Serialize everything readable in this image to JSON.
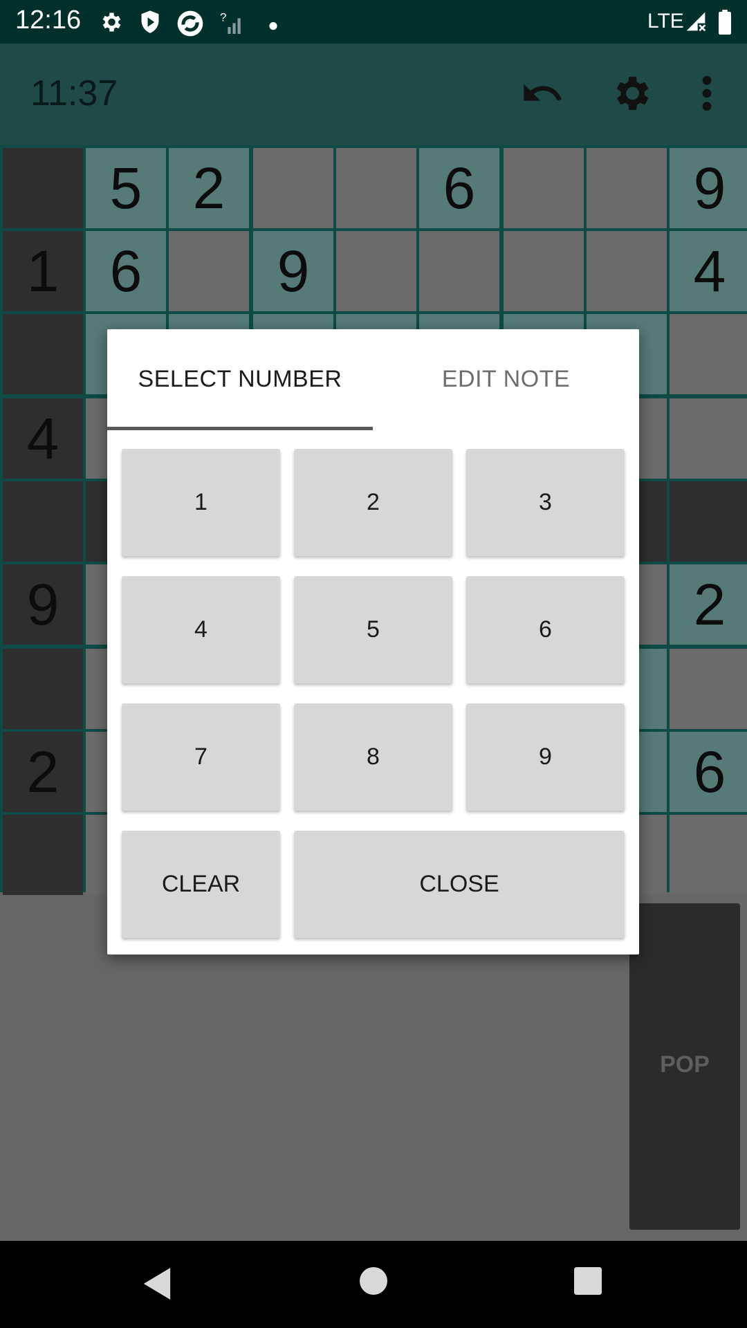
{
  "status_bar": {
    "time": "12:16",
    "network": "LTE",
    "icons": [
      "gear-icon",
      "shield-icon",
      "sync-app-icon",
      "no-signal-icon",
      "dot-icon",
      "signal-x-icon",
      "battery-icon"
    ]
  },
  "toolbar": {
    "timer": "11:37",
    "icons": [
      "undo-icon",
      "settings-icon",
      "more-vert-icon"
    ]
  },
  "board": {
    "rows": [
      [
        "",
        "5",
        "2",
        "",
        "",
        "6",
        "",
        "",
        "9"
      ],
      [
        "1",
        "6",
        "",
        "9",
        "",
        "",
        "",
        "",
        "4"
      ],
      [
        "",
        "",
        "",
        "",
        "",
        "",
        "",
        "",
        ""
      ],
      [
        "4",
        "",
        "",
        "",
        "",
        "",
        "",
        "",
        ""
      ],
      [
        "",
        "",
        "",
        "",
        "",
        "",
        "",
        "",
        ""
      ],
      [
        "9",
        "",
        "",
        "",
        "",
        "",
        "",
        "",
        "2"
      ],
      [
        "",
        "",
        "",
        "",
        "",
        "",
        "",
        "",
        ""
      ],
      [
        "2",
        "",
        "",
        "",
        "",
        "",
        "",
        "",
        "6"
      ],
      [
        "",
        "",
        "",
        "",
        "",
        "",
        "",
        "",
        ""
      ]
    ],
    "colors": {
      "selected": "#2e2e2e",
      "highlight": "#567a76",
      "normal": "#6a6a6a",
      "lines": "#0e4b44"
    }
  },
  "side_panel": {
    "label": "POP"
  },
  "dialog": {
    "tabs": [
      "SELECT NUMBER",
      "EDIT NOTE"
    ],
    "active_tab": "SELECT NUMBER",
    "keys": [
      "1",
      "2",
      "3",
      "4",
      "5",
      "6",
      "7",
      "8",
      "9"
    ],
    "clear_label": "CLEAR",
    "close_label": "CLOSE"
  },
  "nav_bar": {
    "icons": [
      "back-icon",
      "home-icon",
      "recents-icon"
    ]
  }
}
